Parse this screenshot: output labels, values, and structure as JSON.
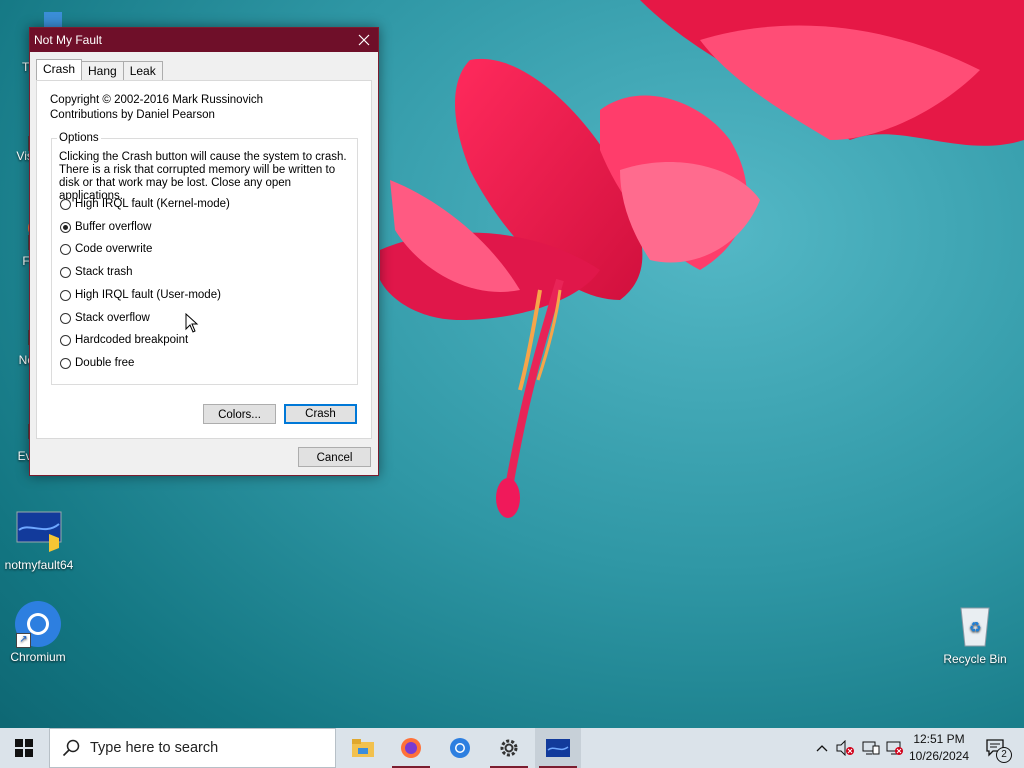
{
  "window": {
    "title": "Not My Fault",
    "tabs": [
      "Crash",
      "Hang",
      "Leak"
    ],
    "copyright": "Copyright © 2002-2016 Mark Russinovich",
    "contributions": "Contributions by Daniel Pearson",
    "options_label": "Options",
    "options_desc": "Clicking the Crash button will cause the system to crash. There is a risk that corrupted memory will be written to disk or that work may be lost. Close any open applications.",
    "options": [
      {
        "label": "High IRQL fault (Kernel-mode)",
        "checked": false
      },
      {
        "label": "Buffer overflow",
        "checked": true
      },
      {
        "label": "Code overwrite",
        "checked": false
      },
      {
        "label": "Stack trash",
        "checked": false
      },
      {
        "label": "High IRQL fault (User-mode)",
        "checked": false
      },
      {
        "label": "Stack overflow",
        "checked": false
      },
      {
        "label": "Hardcoded breakpoint",
        "checked": false
      },
      {
        "label": "Double free",
        "checked": false
      }
    ],
    "colors_button": "Colors...",
    "crash_button": "Crash",
    "cancel_button": "Cancel"
  },
  "desktop": {
    "icons": [
      {
        "label": "Th",
        "icon": "folder-icon"
      },
      {
        "label": "Visu",
        "icon": "visual-studio-icon"
      },
      {
        "label": "F",
        "icon": "firefox-icon"
      },
      {
        "label": "Not",
        "icon": "notepad-icon"
      },
      {
        "label": "Eve",
        "icon": "event-viewer-icon"
      },
      {
        "label": "notmyfault64",
        "icon": "notmyfault-icon"
      },
      {
        "label": "Chromium",
        "icon": "chromium-icon"
      },
      {
        "label": "Recycle Bin",
        "icon": "recycle-bin-icon"
      }
    ]
  },
  "taskbar": {
    "search_placeholder": "Type here to search",
    "time": "12:51 PM",
    "date": "10/26/2024",
    "notification_count": "2"
  },
  "colors": {
    "title_bar": "#6f0f29",
    "default_button_border": "#0078d7"
  }
}
